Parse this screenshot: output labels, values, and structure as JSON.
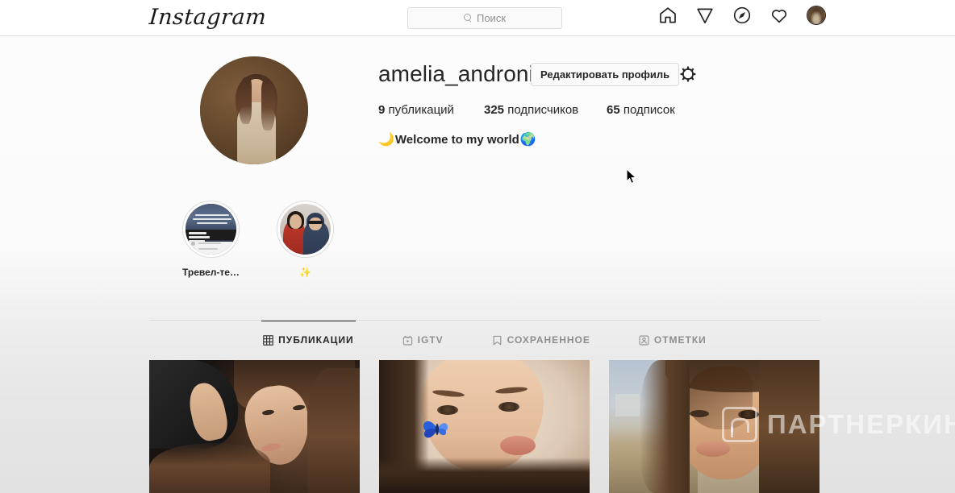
{
  "navbar": {
    "logo_text": "Instagram",
    "search": {
      "placeholder": "Поиск",
      "value": "",
      "icon": "search-icon"
    },
    "icons": [
      {
        "name": "home-icon",
        "label": "Главная"
      },
      {
        "name": "paper-plane-icon",
        "label": "Сообщения"
      },
      {
        "name": "compass-icon",
        "label": "Интересное"
      },
      {
        "name": "heart-icon",
        "label": "Уведомления"
      },
      {
        "name": "profile-avatar-icon",
        "label": "Профиль"
      }
    ]
  },
  "profile": {
    "username": "amelia_andronic",
    "edit_button_label": "Редактировать профиль",
    "settings_icon": "gear-icon",
    "stats": [
      {
        "num": "9",
        "label": " публикаций"
      },
      {
        "num": "325",
        "label": " подписчиков"
      },
      {
        "num": "65",
        "label": " подписок"
      }
    ],
    "bio": {
      "emoji_left": "🌙",
      "text": "Welcome to my world",
      "emoji_right": "🌍"
    }
  },
  "highlights": [
    {
      "label": "Тревел-те…"
    },
    {
      "label": "✨"
    }
  ],
  "tabs": [
    {
      "label": "ПУБЛИКАЦИИ",
      "icon": "grid-icon",
      "active": true
    },
    {
      "label": "IGTV",
      "icon": "igtv-icon",
      "active": false
    },
    {
      "label": "СОХРАНЕННОЕ",
      "icon": "bookmark-icon",
      "active": false
    },
    {
      "label": "ОТМЕТКИ",
      "icon": "tagged-icon",
      "active": false
    }
  ],
  "posts": [
    {
      "alt": "Селфи в темноте"
    },
    {
      "alt": "Селфи с бабочкой"
    },
    {
      "alt": "Селфи на закате в поле"
    }
  ],
  "watermark": {
    "text": "ПАРТНЕРКИН"
  },
  "colors": {
    "accent": "#262626",
    "muted": "#8e8e8e",
    "border": "#dbdbdb",
    "page_bg": "#fafafa"
  }
}
